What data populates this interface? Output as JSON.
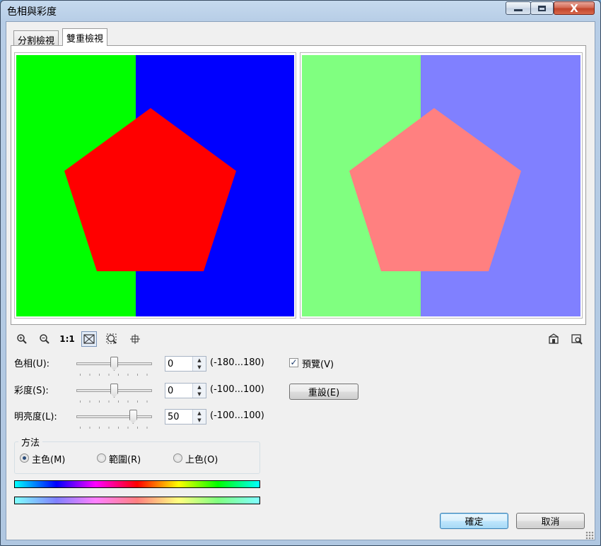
{
  "window": {
    "title": "色相與彩度",
    "minimize_label": "—",
    "maximize_label": "□",
    "close_label": "X"
  },
  "tabs": [
    {
      "label": "分割檢視",
      "active": false
    },
    {
      "label": "雙重檢視",
      "active": true
    }
  ],
  "preview": {
    "original": {
      "left_color": "#00ff00",
      "right_color": "#0000ff",
      "shape_color": "#ff0000"
    },
    "adjusted": {
      "left_color": "#80ff80",
      "right_color": "#8080ff",
      "shape_color": "#ff8080"
    }
  },
  "toolbar": {
    "zoom_in_icon": "zoom-in-icon",
    "zoom_out_icon": "zoom-out-icon",
    "actual_size_label": "1:1",
    "fit_icon": "fit-window-icon",
    "zoom_area_icon": "zoom-area-icon",
    "pan_icon": "pan-icon",
    "right_icon_1": "reset-view-icon",
    "right_icon_2": "preview-window-icon"
  },
  "controls": {
    "hue": {
      "label": "色相(U):",
      "value": "0",
      "range": "(-180...180)",
      "slider_fraction": 0.5
    },
    "saturation": {
      "label": "彩度(S):",
      "value": "0",
      "range": "(-100...100)",
      "slider_fraction": 0.5
    },
    "lightness": {
      "label": "明亮度(L):",
      "value": "50",
      "range": "(-100...100)",
      "slider_fraction": 0.75
    }
  },
  "preview_checkbox": {
    "label": "預覽(V)",
    "checked": true
  },
  "reset_button": "重設(E)",
  "method": {
    "title": "方法",
    "options": [
      {
        "label": "主色(M)",
        "selected": true
      },
      {
        "label": "範圍(R)",
        "selected": false
      },
      {
        "label": "上色(O)",
        "selected": false
      }
    ]
  },
  "buttons": {
    "ok": "確定",
    "cancel": "取消"
  }
}
